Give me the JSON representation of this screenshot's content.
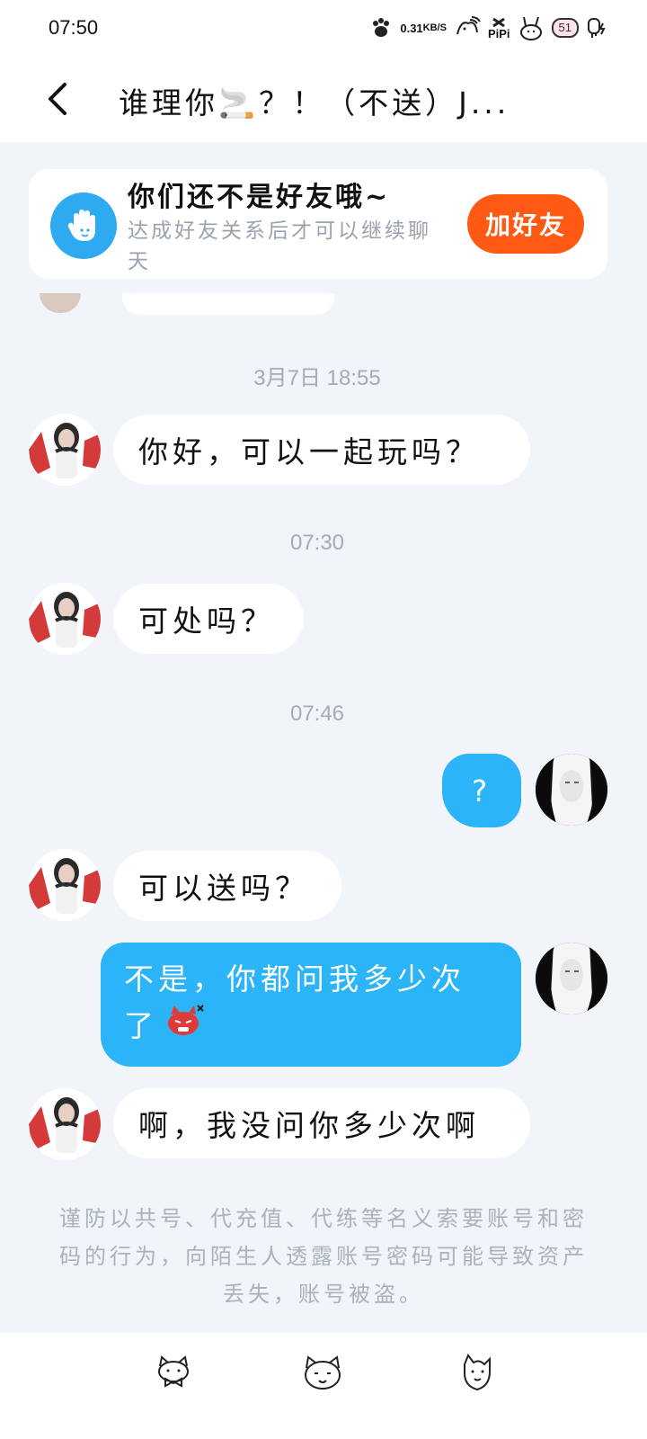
{
  "status_bar": {
    "time": "07:50",
    "net_speed_value": "0.31",
    "net_speed_unit": "KB/S",
    "pipi_label": "PiPi",
    "battery_level": "51"
  },
  "header": {
    "title": "谁理你🚬？！（不送）J..."
  },
  "friend_banner": {
    "title": "你们还不是好友哦~",
    "description": "达成好友关系后才可以继续聊天",
    "button_label": "加好友"
  },
  "messages": {
    "ts1": "3月7日 18:55",
    "m1": "你好，可以一起玩吗？",
    "ts2": "07:30",
    "m2": "可处吗？",
    "ts3": "07:46",
    "m3": "?",
    "m4": "可以送吗？",
    "m5_line1": "不是，你都问我多少次",
    "m5_line2": "了",
    "m6": "啊，我没问你多少次啊"
  },
  "notice": {
    "text": "谨防以共号、代充值、代练等名义索要账号和密码的行为，向陌生人透露账号密码可能导致资产丢失，账号被盗。"
  },
  "colors": {
    "accent_blue": "#2bb4f7",
    "add_friend_orange": "#ff5a14",
    "page_bg": "#f1f4f8"
  },
  "icons": {
    "back": "chevron-left-icon",
    "banner": "hand-wave-icon",
    "bottom": [
      "cat-bow-icon",
      "cat-face-icon",
      "cat-fox-icon"
    ]
  }
}
